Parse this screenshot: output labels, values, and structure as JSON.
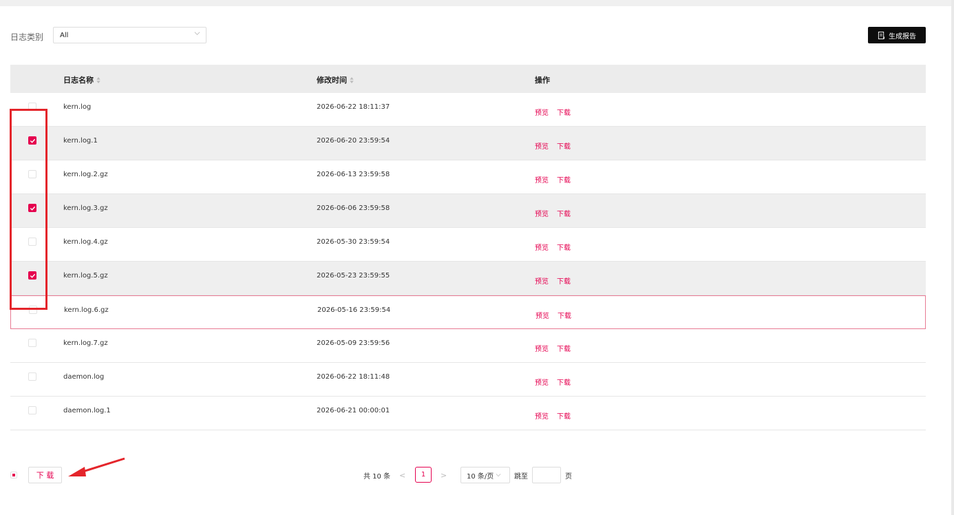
{
  "filter": {
    "label": "日志类别",
    "value": "All"
  },
  "report_button": {
    "label": "生成报告",
    "icon": "document-icon"
  },
  "table": {
    "headers": {
      "name": "日志名称",
      "time": "修改时间",
      "ops": "操作"
    },
    "rows": [
      {
        "name": "kern.log",
        "time": "2026-06-22 18:11:37",
        "checked": false
      },
      {
        "name": "kern.log.1",
        "time": "2026-06-20 23:59:54",
        "checked": true
      },
      {
        "name": "kern.log.2.gz",
        "time": "2026-06-13 23:59:58",
        "checked": false
      },
      {
        "name": "kern.log.3.gz",
        "time": "2026-06-06 23:59:58",
        "checked": true
      },
      {
        "name": "kern.log.4.gz",
        "time": "2026-05-30 23:59:54",
        "checked": false
      },
      {
        "name": "kern.log.5.gz",
        "time": "2026-05-23 23:59:55",
        "checked": true
      },
      {
        "name": "kern.log.6.gz",
        "time": "2026-05-16 23:59:54",
        "checked": false
      },
      {
        "name": "kern.log.7.gz",
        "time": "2026-05-09 23:59:56",
        "checked": false
      },
      {
        "name": "daemon.log",
        "time": "2026-06-22 18:11:48",
        "checked": false
      },
      {
        "name": "daemon.log.1",
        "time": "2026-06-21 00:00:01",
        "checked": false
      }
    ],
    "actions": {
      "preview": "预览",
      "download": "下载"
    }
  },
  "footer": {
    "download_label": "下 载",
    "total": "共 10 条",
    "prev": "<",
    "current_page": "1",
    "next": ">",
    "page_size": "10 条/页",
    "jump_label": "跳至",
    "page_suffix": "页"
  },
  "colors": {
    "accent": "#e5004f",
    "annotation": "#e4252b"
  }
}
